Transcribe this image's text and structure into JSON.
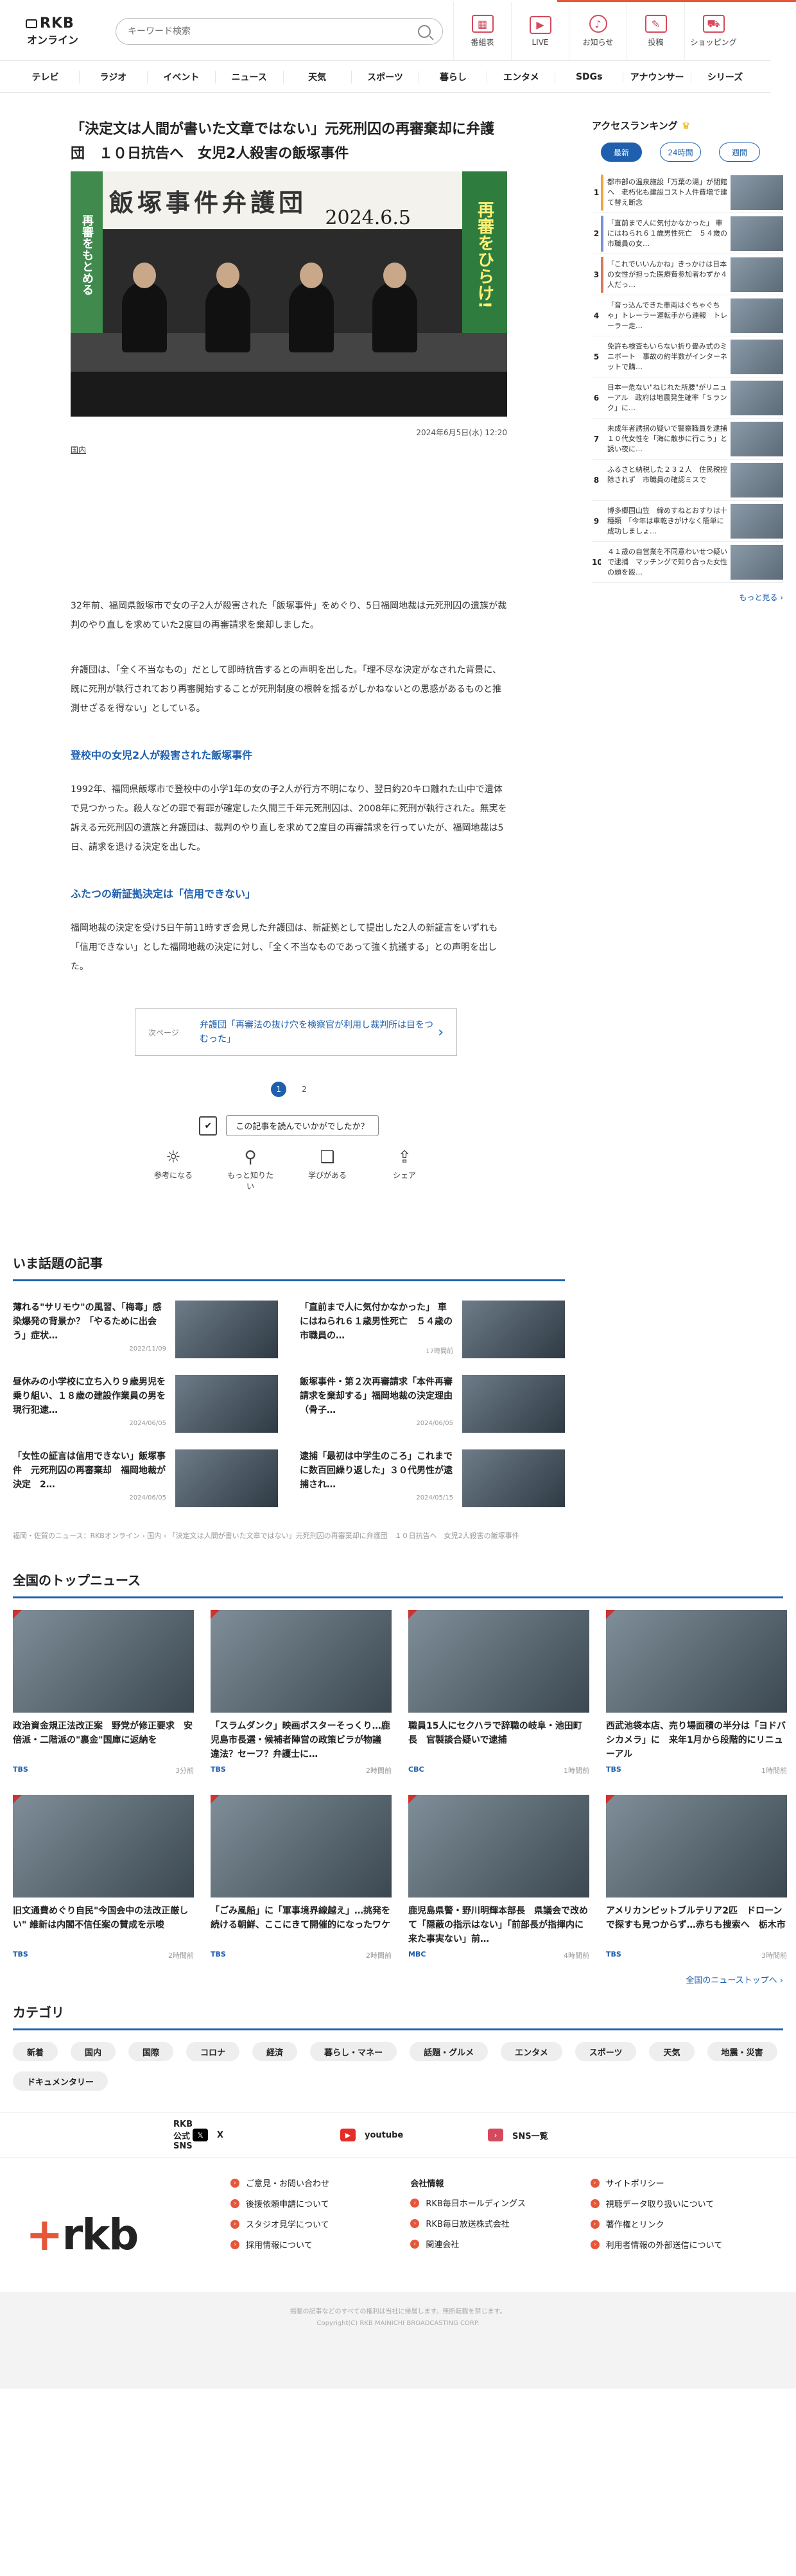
{
  "header": {
    "logo_line1": "RKB",
    "logo_line2": "オンライン",
    "search_placeholder": "キーワード検索",
    "icons": [
      {
        "label": "番組表",
        "icon": "calendar-icon",
        "glyph": "▦"
      },
      {
        "label": "LIVE",
        "icon": "live-icon",
        "glyph": "▶"
      },
      {
        "label": "お知らせ",
        "icon": "bell-icon",
        "glyph": "♪"
      },
      {
        "label": "投稿",
        "icon": "post-icon",
        "glyph": "✎"
      },
      {
        "label": "ショッピング",
        "icon": "cart-icon",
        "glyph": "⛟"
      }
    ]
  },
  "nav": [
    "テレビ",
    "ラジオ",
    "イベント",
    "ニュース",
    "天気",
    "スポーツ",
    "暮らし",
    "エンタメ",
    "SDGs",
    "アナウンサー",
    "シリーズ"
  ],
  "article": {
    "title": "「決定文は人間が書いた文章ではない」元死刑囚の再審棄却に弁護団　１０日抗告へ　女児2人殺害の飯塚事件",
    "hero_banner": "飯塚事件弁護団",
    "hero_date": "2024.6.5",
    "hero_sign_right": "再審をひらけ!",
    "hero_sign_left": "再審をもとめる",
    "photo_date": "2024年6月5日(水) 12:20",
    "category": "国内",
    "p1": "32年前、福岡県飯塚市で女の子2人が殺害された「飯塚事件」をめぐり、5日福岡地裁は元死刑囚の遺族が裁判のやり直しを求めていた2度目の再審請求を棄却しました。",
    "p2": "弁護団は、「全く不当なもの」だとして即時抗告するとの声明を出した。「理不尽な決定がなされた背景に、既に死刑が執行されており再審開始することが死刑制度の根幹を揺るがしかねないとの思惑があるものと推測せざるを得ない」としている。",
    "h1": "登校中の女児2人が殺害された飯塚事件",
    "p3": "1992年、福岡県飯塚市で登校中の小学1年の女の子2人が行方不明になり、翌日約20キロ離れた山中で遺体で見つかった。殺人などの罪で有罪が確定した久間三千年元死刑囚は、2008年に死刑が執行された。無実を訴える元死刑囚の遺族と弁護団は、裁判のやり直しを求めて2度目の再審請求を行っていたが、福岡地裁は5日、請求を退ける決定を出した。",
    "h2": "ふたつの新証拠決定は「信用できない」",
    "p4": "福岡地裁の決定を受け5日午前11時すぎ会見した弁護団は、新証拠として提出した2人の新証言をいずれも「信用できない」とした福岡地裁の決定に対し、「全く不当なものであって強く抗議する」との声明を出した。",
    "next_label": "次ページ",
    "next_text": "弁護団「再審法の抜け穴を検察官が利用し裁判所は目をつむった」",
    "pages": [
      "1",
      "2"
    ],
    "survey_question": "この記事を読んでいかがでしたか？",
    "reactions": [
      {
        "label": "参考になる",
        "icon": "bulb-icon",
        "glyph": "☼"
      },
      {
        "label": "もっと知りたい",
        "icon": "search-icon",
        "glyph": "⚲"
      },
      {
        "label": "学びがある",
        "icon": "book-icon",
        "glyph": "❑"
      },
      {
        "label": "シェア",
        "icon": "share-icon",
        "glyph": "⇪"
      }
    ]
  },
  "ranking": {
    "title": "アクセスランキング",
    "tabs": [
      "最新",
      "24時間",
      "週間"
    ],
    "items": [
      {
        "num": "1",
        "text": "都市部の温泉施設「万葉の湯」が閉館へ　老朽化も建設コスト人件費増で建て替え断念",
        "color": "#f0a53a"
      },
      {
        "num": "2",
        "text": "「直前まで人に気付かなかった」 車にはねられ６１歳男性死亡　５４歳の市職員の女…",
        "color": "#7b8fd4"
      },
      {
        "num": "3",
        "text": "「これでいいんかね」きっかけは日本の女性が担った医療費参加者わずか４人だっ…",
        "color": "#d9775d"
      },
      {
        "num": "4",
        "text": "「音っ込んできた車両はぐちゃぐちゃ」トレーラー運転手から連報　トレーラー走…",
        "color": "#ffffff"
      },
      {
        "num": "5",
        "text": "免許も検査もいらない折り畳み式のミニボート　事故の約半数がインターネットで購…",
        "color": "#ffffff"
      },
      {
        "num": "6",
        "text": "日本一危ない\"ねじれた所腰\"がリニューアル　政府は地震発生確率「Ｓランク」に…",
        "color": "#ffffff"
      },
      {
        "num": "7",
        "text": "未成年者誘拐の疑いで警察職員を逮捕　１０代女性を「海に散歩に行こう」と誘い夜に…",
        "color": "#ffffff"
      },
      {
        "num": "8",
        "text": "ふるさと納税した２３２人　住民税控除されず　市職員の確認ミスで",
        "color": "#ffffff"
      },
      {
        "num": "9",
        "text": "博多郷国山笠　締めすねとおすりは十種類　「今年は車乾きがけなく簡単に成功しましょ…",
        "color": "#ffffff"
      },
      {
        "num": "10",
        "text": "４１歳の自営業を不同意わいせつ疑いで逮捕　マッチングで知り合った女性の頭を殴…",
        "color": "#ffffff"
      }
    ],
    "more": "もっと見る ›"
  },
  "hot": {
    "title": "いま話題の記事",
    "items": [
      {
        "text": "薄れる\"サリモウ\"の風習、「梅毒」感染爆発の背景か？「やるために出会う」症状…",
        "date": "2022/11/09"
      },
      {
        "text": "「直前まで人に気付かなかった」 車にはねられ６１歳男性死亡　５４歳の市職員の…",
        "date": "17時間前"
      },
      {
        "text": "昼休みの小学校に立ち入り９歳男児を乗り組い、１８歳の建設作業員の男を現行犯逮…",
        "date": "2024/06/05"
      },
      {
        "text": "飯塚事件・第２次再審請求「本件再審請求を棄却する」福岡地裁の決定理由（骨子…",
        "date": "2024/06/05"
      },
      {
        "text": "「女性の証言は信用できない」飯塚事件　元死刑囚の再審棄却　福岡地裁が決定　2…",
        "date": "2024/06/05"
      },
      {
        "text": "逮捕「最初は中学生のころ」これまでに数百回繰り返した」３０代男性が逮捕され…",
        "date": "2024/05/15"
      }
    ],
    "breadcrumb": "福岡・佐賀のニュース：RKBオンライン › 国内 › 「決定文は人間が書いた文章ではない」元死刑囚の再審棄却に弁護団　１０日抗告へ　女児2人殺害の飯塚事件"
  },
  "national": {
    "title": "全国のトップニュース",
    "items": [
      {
        "text": "政治資金規正法改正案　野党が修正要求　安倍派・二階派の\"裏金\"国庫に返納を",
        "src": "TBS",
        "time": "3分前"
      },
      {
        "text": "「スラムダンク」映画ポスターそっくり…鹿児島市長選・候補者陣営の政策ビラが物議　違法？セーフ？弁護士に…",
        "src": "TBS",
        "time": "2時間前"
      },
      {
        "text": "職員15人にセクハラで辞職の岐阜・池田町長　官製談合疑いで逮捕",
        "src": "CBC",
        "time": "1時間前"
      },
      {
        "text": "西武池袋本店、売り場面積の半分は「ヨドバシカメラ」に　来年1月から段階的にリニューアル",
        "src": "TBS",
        "time": "1時間前"
      },
      {
        "text": "旧文通費めぐり自民\"今国会中の法改正厳しい\" 維新は内閣不信任案の賛成を示唆",
        "src": "TBS",
        "time": "2時間前"
      },
      {
        "text": "「ごみ風船」に「軍事境界線越え」…挑発を続ける朝鮮、ここにきて開催的になったワケ",
        "src": "TBS",
        "time": "2時間前"
      },
      {
        "text": "鹿児島県警・野川明輝本部長　県議会で改めて「隠蔽の指示はない」「前部長が指揮内に来た事実ない」前…",
        "src": "MBC",
        "time": "4時間前"
      },
      {
        "text": "アメリカンピットブルテリア2匹　ドローンで探すも見つからず…赤ちも捜索へ　栃木市",
        "src": "TBS",
        "time": "3時間前"
      }
    ],
    "more": "全国のニューストップへ ›"
  },
  "categories": {
    "title": "カテゴリ",
    "items": [
      "新着",
      "国内",
      "国際",
      "コロナ",
      "経済",
      "暮らし・マネー",
      "話題・グルメ",
      "エンタメ",
      "スポーツ",
      "天気",
      "地震・災害",
      "ドキュメンタリー"
    ]
  },
  "sns": {
    "label": "RKB公式SNS",
    "items": [
      {
        "label": "X",
        "icon": "x-icon",
        "glyph": "𝕏",
        "color": "#000000"
      },
      {
        "label": "youtube",
        "icon": "youtube-icon",
        "glyph": "▶",
        "color": "#e52d27"
      },
      {
        "label": "SNS一覧",
        "icon": "arrow-icon",
        "glyph": "›",
        "color": "#d44a5c"
      }
    ]
  },
  "footer": {
    "logo": "rkb",
    "col1": [
      "ご意見・お問い合わせ",
      "後援依頼申請について",
      "スタジオ見学について",
      "採用情報について"
    ],
    "col2_head": "会社情報",
    "col2": [
      "RKB毎日ホールディングス",
      "RKB毎日放送株式会社",
      "関連会社"
    ],
    "col3": [
      "サイトポリシー",
      "視聴データ取り扱いについて",
      "著作権とリンク",
      "利用者情報の外部送信について"
    ],
    "copy1": "掲載の記事などのすべての権利は当社に帰属します。無断転載を禁じます。",
    "copy2": "Copyright(C) RKB MAINICHI BROADCASTING CORP."
  }
}
